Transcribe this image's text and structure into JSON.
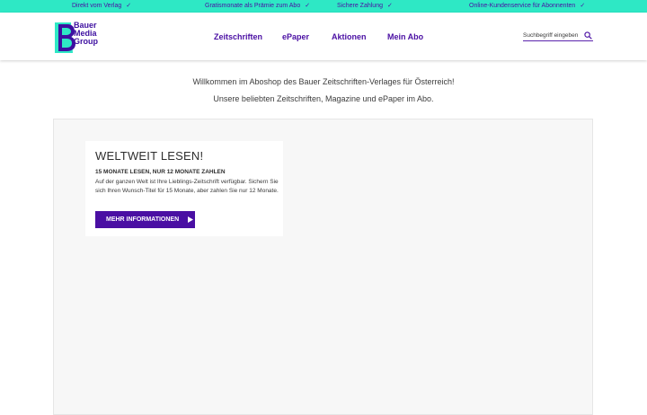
{
  "topbar": {
    "items": [
      {
        "label": "Direkt vom Verlag",
        "check": "✓"
      },
      {
        "label": "Gratismonate als Prämie zum Abo",
        "check": "✓"
      },
      {
        "label": "Sichere Zahlung",
        "check": "✓"
      },
      {
        "label": "Online-Kundenservice für Abonnenten",
        "check": "✓"
      }
    ]
  },
  "header": {
    "logo": {
      "line1": "Bauer",
      "line2": "Media",
      "line3": "Group"
    },
    "nav": [
      {
        "label": "Zeitschriften"
      },
      {
        "label": "ePaper"
      },
      {
        "label": "Aktionen"
      },
      {
        "label": "Mein Abo"
      }
    ],
    "search": {
      "placeholder": "Suchbegriff eingeben",
      "icon": "search-icon"
    }
  },
  "intro": {
    "line1": "Willkommen im Aboshop des Bauer Zeitschriften-Verlages für Österreich!",
    "line2": "Unsere beliebten Zeitschriften, Magazine und ePaper im Abo."
  },
  "teaser": {
    "title": "WELTWEIT LESEN!",
    "subtitle": "15 MONATE LESEN, NUR 12 MONATE ZAHLEN",
    "body": "Auf der ganzen Welt ist Ihre Lieblings-Zeitschrift verfügbar. Sichern Sie sich Ihren Wunsch-Titel für 15 Monate, aber zahlen Sie nur 12 Monate.",
    "button_label": "MEHR INFORMATIONEN",
    "button_icon": "caret-right-icon"
  },
  "colors": {
    "accent": "#2ee8c5",
    "brand": "#4a0fa3"
  }
}
